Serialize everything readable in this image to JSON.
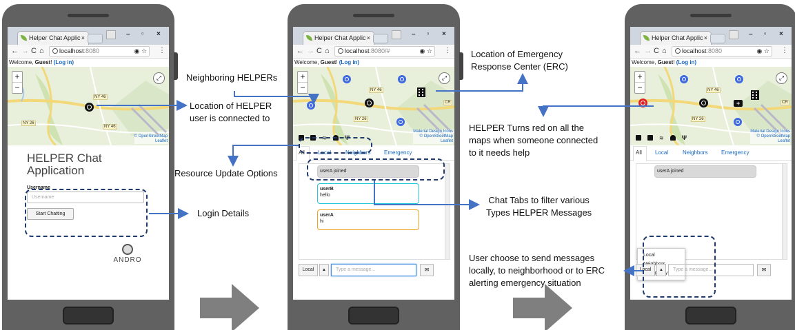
{
  "browser": {
    "tab_title": "Helper Chat Applic",
    "tab_close": "×",
    "window_min": "–",
    "window_max": "▫",
    "window_close": "×",
    "back": "←",
    "forward": "→",
    "reload": "C",
    "home": "⌂",
    "star": "☆",
    "target": "◉",
    "menu": "⋮",
    "url_host": "localhost",
    "url_port_1": ":8080",
    "url_port_2": ":8080/#",
    "url_port_3": ":8080",
    "welcome_text": "Welcome, ",
    "welcome_user": "Guest",
    "welcome_bang": "! ",
    "login_link": "(Log in)"
  },
  "map": {
    "zoom_in": "+",
    "zoom_out": "−",
    "expand": "⤢",
    "road_ny46": "NY 46",
    "road_ny26": "NY 26",
    "road_cr": "CR",
    "attrib_1": "Material Design Icons",
    "attrib_2": "© OpenStreetMap",
    "attrib_3": "Leaflet",
    "attrib_short": "© OpenStreetMap"
  },
  "login": {
    "title_line1": "HELPER Chat",
    "title_line2": "Application",
    "username_label": "Username",
    "username_placeholder": "Username",
    "start_button": "Start Chatting",
    "logo_text": "ANDRO"
  },
  "tabs": [
    "All",
    "Local",
    "Neighbors",
    "Emergency"
  ],
  "chat": {
    "joined": "userA joined",
    "msg2_user": "userB",
    "msg2_text": "hello",
    "msg3_user": "userA",
    "msg3_text": "hi"
  },
  "input": {
    "scope": "Local",
    "caret": "▲",
    "placeholder": "Type a message...",
    "send": "✉"
  },
  "dropdown": [
    "Local",
    "Neighbors",
    "Emergency"
  ],
  "annotations": {
    "neighbors": "Neighboring HELPERs",
    "location_line1": "Location of HELPER",
    "location_line2": "user is connected to",
    "resource": "Resource Update Options",
    "login_details": "Login Details",
    "erc_line1": "Location of Emergency",
    "erc_line2": "Response Center (ERC)",
    "red_line1": "HELPER Turns red on all the",
    "red_line2": "maps when someone connected",
    "red_line3": "to it needs help",
    "tabs_line1": "Chat Tabs to filter various",
    "tabs_line2": "Types HELPER Messages",
    "send_line1": "User choose to send messages",
    "send_line2": "locally, to neighborhood or to ERC",
    "send_line3": "alerting emergency situation"
  },
  "colors": {
    "arrow": "#4472c4",
    "dashed": "#1f3a6b",
    "big_arrow": "#7f7f7f",
    "phone": "#616161",
    "marker_blue": "#3f6ae0",
    "marker_red": "#e02020"
  }
}
